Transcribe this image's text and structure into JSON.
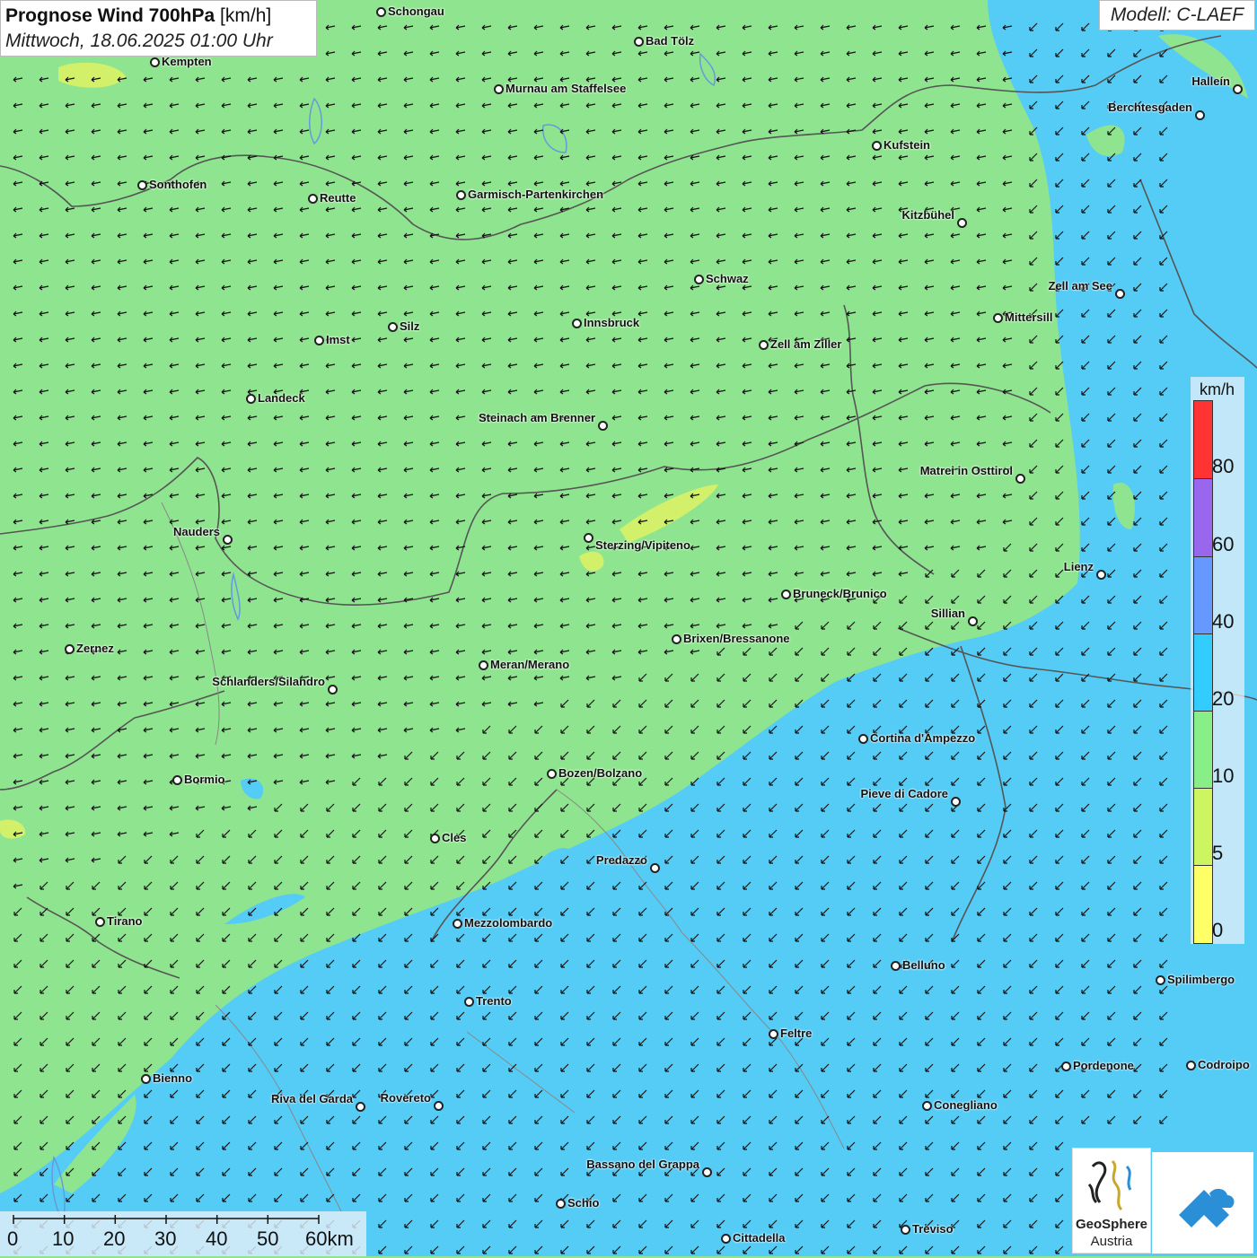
{
  "title": {
    "main_bold": "Prognose Wind 700hPa",
    "main_unit": "[km/h]",
    "date": "Mittwoch, 18.06.2025 01:00 Uhr"
  },
  "model": "Modell: C-LAEF",
  "legend": {
    "unit": "km/h",
    "labels": [
      "80",
      "60",
      "40",
      "20",
      "10",
      "5",
      "0"
    ],
    "colors": {
      "80": "#ff3333",
      "60": "#9966ee",
      "40": "#6699ff",
      "20": "#33ccff",
      "10": "#88ee88",
      "5": "#ccf55f",
      "0": "#ffff66"
    }
  },
  "scale": {
    "labels": [
      "0",
      "10",
      "20",
      "30",
      "40",
      "50",
      "60km"
    ]
  },
  "logos": {
    "geosphere_line1": "GeoSphere",
    "geosphere_line2": "Austria"
  },
  "field_colors": {
    "green_10_20": "#8fe58f",
    "blue_20_40": "#55ccf5",
    "yellow_5_10": "#d2f06a"
  },
  "cities": [
    {
      "name": "Schongau"
    },
    {
      "name": "Bad Tölz"
    },
    {
      "name": "Kempten"
    },
    {
      "name": "Murnau am Staffelsee"
    },
    {
      "name": "Halleín"
    },
    {
      "name": "Berchtesgaden"
    },
    {
      "name": "Kufstein"
    },
    {
      "name": "Sonthofen"
    },
    {
      "name": "Reutte"
    },
    {
      "name": "Garmisch-Partenkirchen"
    },
    {
      "name": "Kitzbühel"
    },
    {
      "name": "Schwaz"
    },
    {
      "name": "Zell am See"
    },
    {
      "name": "Mittersill"
    },
    {
      "name": "Silz"
    },
    {
      "name": "Innsbruck"
    },
    {
      "name": "Imst"
    },
    {
      "name": "Zell am Ziller"
    },
    {
      "name": "Landeck"
    },
    {
      "name": "Steinach am Brenner"
    },
    {
      "name": "Matrei in Osttirol"
    },
    {
      "name": "Nauders"
    },
    {
      "name": "Sterzing/Vipiteno"
    },
    {
      "name": "Lienz"
    },
    {
      "name": "Bruneck/Brunico"
    },
    {
      "name": "Sillian"
    },
    {
      "name": "Brixen/Bressanone"
    },
    {
      "name": "Zernez"
    },
    {
      "name": "Meran/Merano"
    },
    {
      "name": "Schlanders/Silandro"
    },
    {
      "name": "Cortina d'Ampezzo"
    },
    {
      "name": "Bormio"
    },
    {
      "name": "Bozen/Bolzano"
    },
    {
      "name": "Pieve di Cadore"
    },
    {
      "name": "Cles"
    },
    {
      "name": "Predazzo"
    },
    {
      "name": "Tirano"
    },
    {
      "name": "Mezzolombardo"
    },
    {
      "name": "Belluno"
    },
    {
      "name": "Spilimbergo"
    },
    {
      "name": "Trento"
    },
    {
      "name": "Feltre"
    },
    {
      "name": "Bienno"
    },
    {
      "name": "Pordenone"
    },
    {
      "name": "Codroipo"
    },
    {
      "name": "Riva del Garda"
    },
    {
      "name": "Rovereto"
    },
    {
      "name": "Conegliano"
    },
    {
      "name": "Bassano del Grappa"
    },
    {
      "name": "Schio"
    },
    {
      "name": "Treviso"
    },
    {
      "name": "Cittadella"
    }
  ]
}
